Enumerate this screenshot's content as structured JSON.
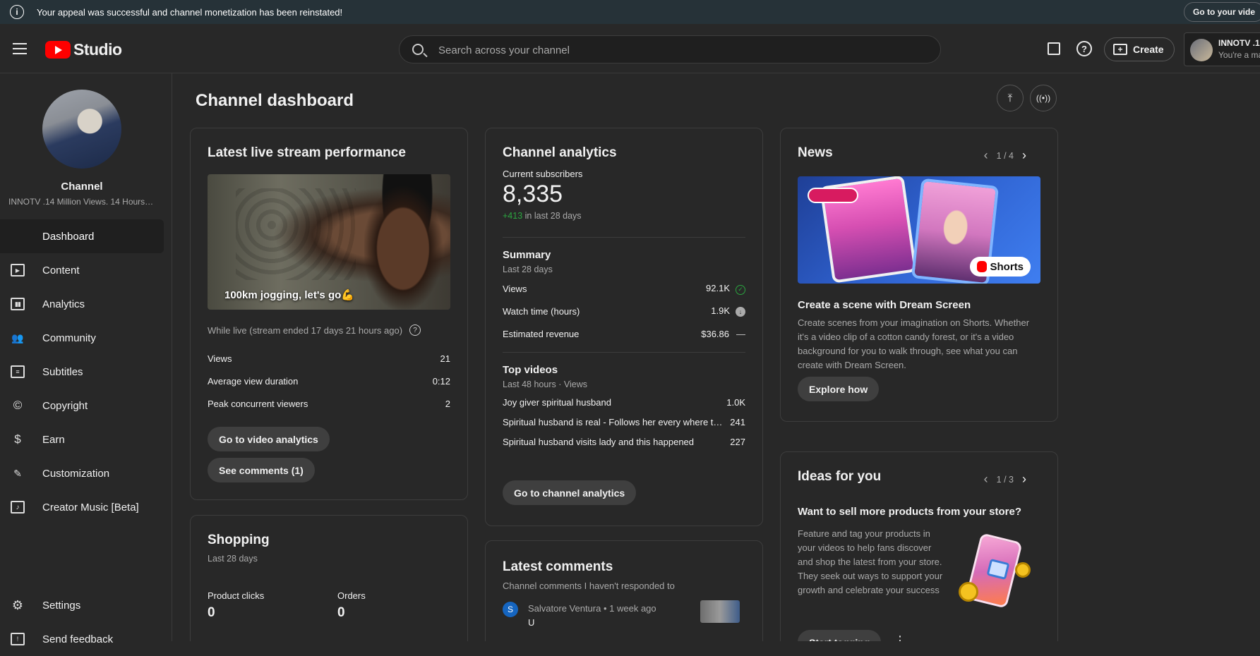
{
  "banner": {
    "message": "Your appeal was successful and channel monetization has been reinstated!",
    "go_label": "Go to your vide"
  },
  "topbar": {
    "logo_text": "Studio",
    "search_placeholder": "Search across your channel",
    "create_label": "Create",
    "account_name": "INNOTV .1",
    "account_sub": "You're a ma"
  },
  "sidebar": {
    "channel_title": "Channel",
    "channel_sub": "INNOTV .14 Million Views. 14 Hours…",
    "items": [
      {
        "label": "Dashboard"
      },
      {
        "label": "Content"
      },
      {
        "label": "Analytics"
      },
      {
        "label": "Community"
      },
      {
        "label": "Subtitles"
      },
      {
        "label": "Copyright"
      },
      {
        "label": "Earn"
      },
      {
        "label": "Customization"
      },
      {
        "label": "Creator Music [Beta]"
      }
    ],
    "settings_label": "Settings",
    "feedback_label": "Send feedback"
  },
  "main": {
    "title": "Channel dashboard"
  },
  "live": {
    "title": "Latest live stream performance",
    "video_title": "100km jogging, let's go💪",
    "status": "While live (stream ended 17 days 21 hours ago)",
    "stats": [
      {
        "label": "Views",
        "value": "21"
      },
      {
        "label": "Average view duration",
        "value": "0:12"
      },
      {
        "label": "Peak concurrent viewers",
        "value": "2"
      }
    ],
    "analytics_btn": "Go to video analytics",
    "comments_btn": "See comments (1)"
  },
  "shopping": {
    "title": "Shopping",
    "period": "Last 28 days",
    "product_clicks_label": "Product clicks",
    "product_clicks_value": "0",
    "orders_label": "Orders",
    "orders_value": "0"
  },
  "analytics": {
    "title": "Channel analytics",
    "subs_label": "Current subscribers",
    "subs_value": "8,335",
    "subs_delta": "+413",
    "subs_delta_suffix": "in last 28 days",
    "summary_title": "Summary",
    "summary_period": "Last 28 days",
    "summary": [
      {
        "label": "Views",
        "value": "92.1K",
        "icon": "check-circle"
      },
      {
        "label": "Watch time (hours)",
        "value": "1.9K",
        "icon": "down-arrow-circle"
      },
      {
        "label": "Estimated revenue",
        "value": "$36.86",
        "icon": "dash"
      }
    ],
    "top_title": "Top videos",
    "top_period": "Last 48 hours · Views",
    "top_videos": [
      {
        "title": "Joy giver spiritual husband",
        "views": "1.0K"
      },
      {
        "title": "Spiritual husband is real - Follows her every where t…",
        "views": "241"
      },
      {
        "title": "Spiritual husband visits lady and this happened",
        "views": "227"
      }
    ],
    "button": "Go to channel analytics"
  },
  "comments": {
    "title": "Latest comments",
    "subtitle": "Channel comments I haven't responded to",
    "first": {
      "initial": "S",
      "author": "Salvatore Ventura",
      "time": "1 week ago",
      "text": "U"
    }
  },
  "news": {
    "title": "News",
    "pager": "1 / 4",
    "shorts_label": "Shorts",
    "headline": "Create a scene with Dream Screen",
    "body": "Create scenes from your imagination on Shorts. Whether it's a video clip of a cotton candy forest, or it's a video background for you to walk through, see what you can create with Dream Screen.",
    "button": "Explore how"
  },
  "ideas": {
    "title": "Ideas for you",
    "pager": "1 / 3",
    "headline": "Want to sell more products from your store?",
    "body": "Feature and tag your products in your videos to help fans discover and shop the latest from your store. They seek out ways to support your growth and celebrate your success",
    "button": "Start tagging"
  },
  "colors": {
    "banner_bg": "#263238",
    "delta_green": "#2ba640",
    "brand_red": "#ff0000"
  }
}
